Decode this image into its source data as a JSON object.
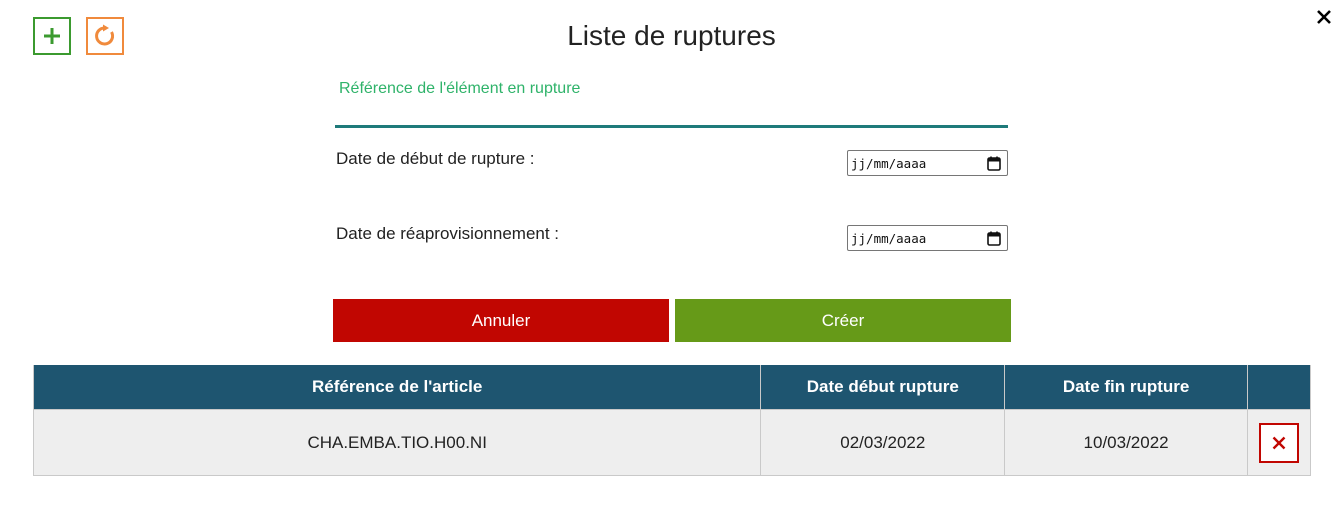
{
  "title": "Liste de ruptures",
  "toolbar": {
    "add_icon": "plus-icon",
    "refresh_icon": "refresh-icon",
    "close_icon": "close-icon",
    "add_color": "#3b9a2f",
    "refresh_color": "#f08a3c"
  },
  "form": {
    "reference_label": "Référence de l'élément en rupture",
    "reference_value": "",
    "start_date_label": "Date de début de rupture :",
    "start_date_placeholder": "jj/mm/aaaa",
    "restock_date_label": "Date de réaprovisionnement :",
    "restock_date_placeholder": "jj/mm/aaaa",
    "cancel_label": "Annuler",
    "create_label": "Créer",
    "cancel_color": "#c10601",
    "create_color": "#669a18",
    "accent_color": "#2fb36a",
    "underline_color": "#1e7a7a"
  },
  "table": {
    "header_color": "#1e5570",
    "columns": [
      "Référence de l'article",
      "Date début rupture",
      "Date fin rupture",
      ""
    ],
    "rows": [
      {
        "reference": "CHA.EMBA.TIO.H00.NI",
        "start": "02/03/2022",
        "end": "10/03/2022",
        "delete_icon": "delete-x-icon"
      }
    ]
  }
}
